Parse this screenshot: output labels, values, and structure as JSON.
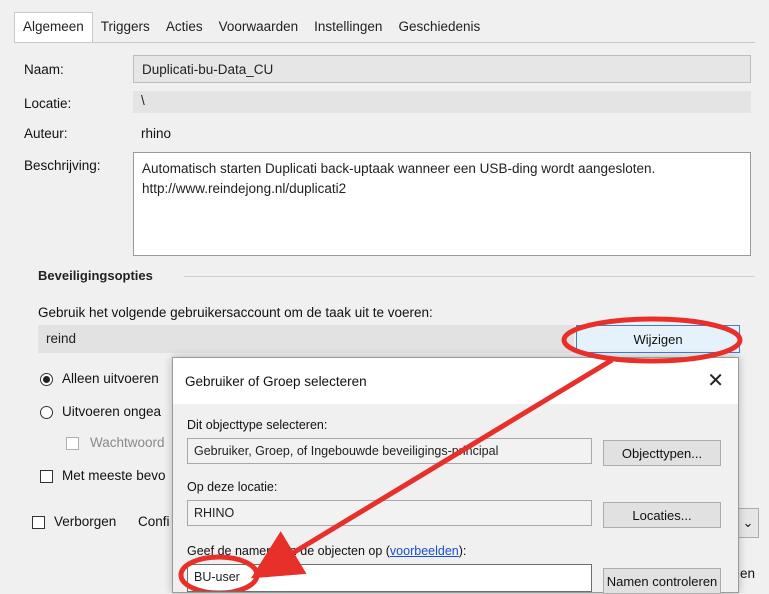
{
  "tabs": [
    "Algemeen",
    "Triggers",
    "Acties",
    "Voorwaarden",
    "Instellingen",
    "Geschiedenis"
  ],
  "general": {
    "name_label": "Naam:",
    "name_value": "Duplicati-bu-Data_CU",
    "location_label": "Locatie:",
    "location_value": "\\",
    "author_label": "Auteur:",
    "author_value": "rhino",
    "description_label": "Beschrijving:",
    "description_line1": "Automatisch starten Duplicati back-uptaak wanneer een USB-ding wordt aangesloten.",
    "description_line2": "http://www.reindejong.nl/duplicati2"
  },
  "security": {
    "group_title": "Beveiligingsopties",
    "account_prompt": "Gebruik het volgende gebruikersaccount om de taak uit te voeren:",
    "account_value": "reind",
    "change_button": "Wijzigen",
    "radio_only_logged_on": "Alleen uitvoeren",
    "radio_run_regardless": "Uitvoeren ongea",
    "check_no_password": "Wachtwoord",
    "check_highest_privileges": "Met meeste bevo",
    "check_hidden": "Verborgen",
    "configure_label": "Confi"
  },
  "dialog": {
    "title": "Gebruiker of Groep selecteren",
    "close_glyph": "✕",
    "objecttype_label": "Dit objecttype selecteren:",
    "objecttype_value": "Gebruiker, Groep, of Ingebouwde beveiligings-principal",
    "objecttypes_button": "Objecttypen...",
    "location_label": "Op deze locatie:",
    "location_value": "RHINO",
    "locations_button": "Locaties...",
    "names_label_prefix": "Geef de namen van de objecten op (",
    "names_label_link": "voorbeelden",
    "names_label_suffix": "):",
    "names_value": "BU-user",
    "check_names_button": "Namen controleren"
  },
  "behind_dialog": {
    "partial_button": "en",
    "dropdown_glyph": "⌄"
  },
  "colors": {
    "annotation_red": "#e8302a",
    "focus_blue": "#3c7fd0",
    "link_blue": "#1a4fd0"
  }
}
